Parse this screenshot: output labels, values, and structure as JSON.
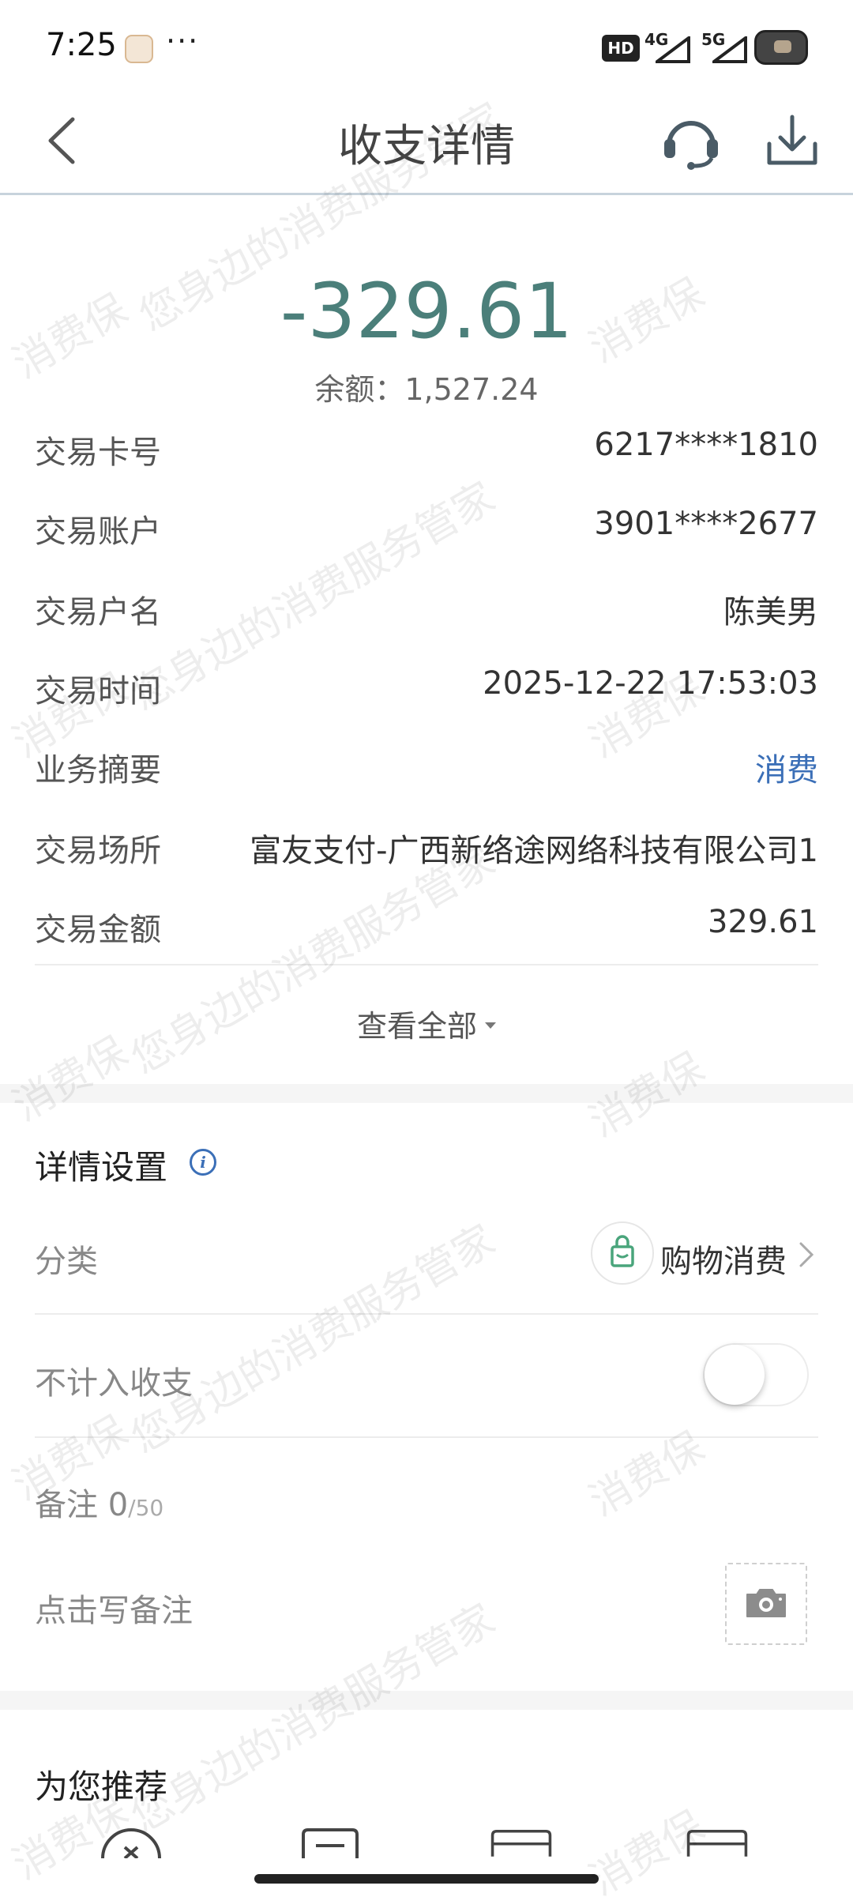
{
  "status_bar": {
    "time": "7:25",
    "dots": "···",
    "hd": "HD",
    "net_4g": "4G",
    "net_5g": "5G"
  },
  "header": {
    "title": "收支详情"
  },
  "summary": {
    "amount": "-329.61",
    "balance": "余额：1,527.24"
  },
  "details": [
    {
      "label": "交易卡号",
      "value": "6217****1810"
    },
    {
      "label": "交易账户",
      "value": "3901****2677"
    },
    {
      "label": "交易户名",
      "value": "陈美男"
    },
    {
      "label": "交易时间",
      "value": "2025-12-22 17:53:03"
    },
    {
      "label": "业务摘要",
      "value": "消费"
    },
    {
      "label": "交易场所",
      "value": "富友支付-广西新络途网络科技有限公司1"
    },
    {
      "label": "交易金额",
      "value": "329.61"
    }
  ],
  "view_all": "查看全部",
  "settings": {
    "title": "详情设置",
    "category_label": "分类",
    "category_value": "购物消费",
    "exclude_label": "不计入收支",
    "exclude_on": false,
    "note_label": "备注",
    "note_count": "0",
    "note_max": "/50",
    "note_placeholder": "点击写备注"
  },
  "recommend": {
    "title": "为您推荐"
  },
  "watermark": {
    "line1": "消费保",
    "line2": "您身边的消费服务管家"
  },
  "colors": {
    "amount": "#4b7f7a",
    "link": "#3b6fb7",
    "accent_green": "#4aa57c"
  }
}
